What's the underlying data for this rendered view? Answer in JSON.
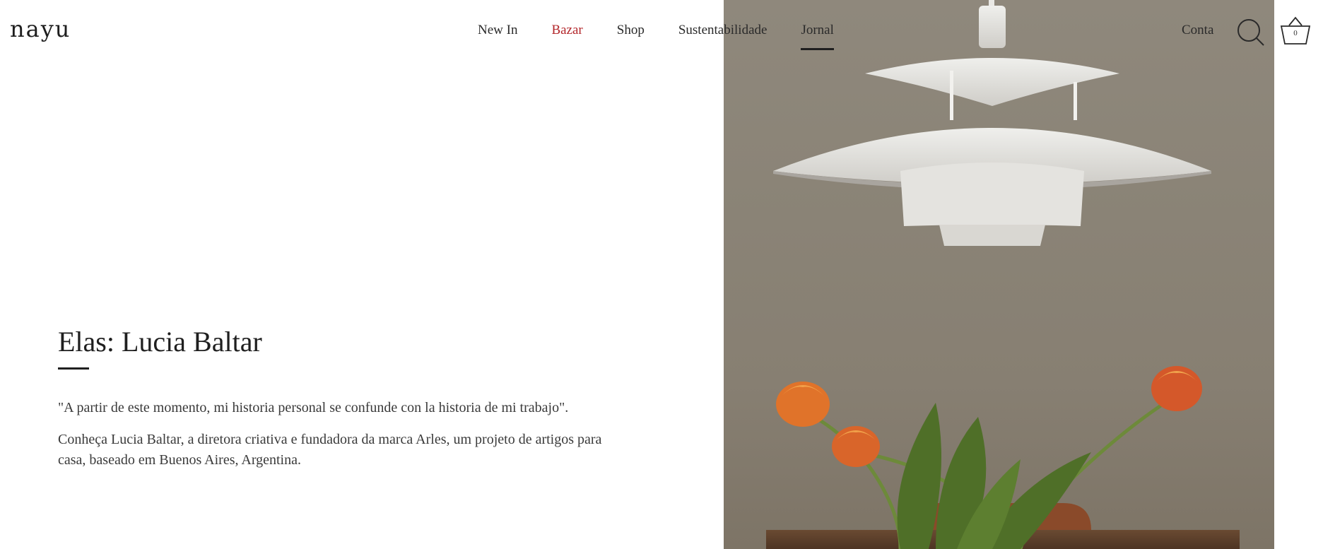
{
  "header": {
    "logo": "nayu",
    "nav": [
      {
        "label": "New In"
      },
      {
        "label": "Bazar"
      },
      {
        "label": "Shop"
      },
      {
        "label": "Sustentabilidade"
      },
      {
        "label": "Jornal"
      }
    ],
    "account_label": "Conta",
    "cart_count": "0"
  },
  "article": {
    "title": "Elas: Lucia Baltar",
    "quote": "\"A partir de este momento, mi historia personal se confunde con la historia de mi trabajo\".",
    "intro": "Conheça Lucia Baltar, a diretora criativa e fundadora da marca Arles, um projeto de artigos para casa, baseado em Buenos Aires, Argentina."
  },
  "colors": {
    "accent_red": "#b3272b",
    "photo_background": "#8a8376",
    "text": "#2a2a2a"
  },
  "icons": {
    "search": "search-icon",
    "cart": "basket-icon"
  }
}
